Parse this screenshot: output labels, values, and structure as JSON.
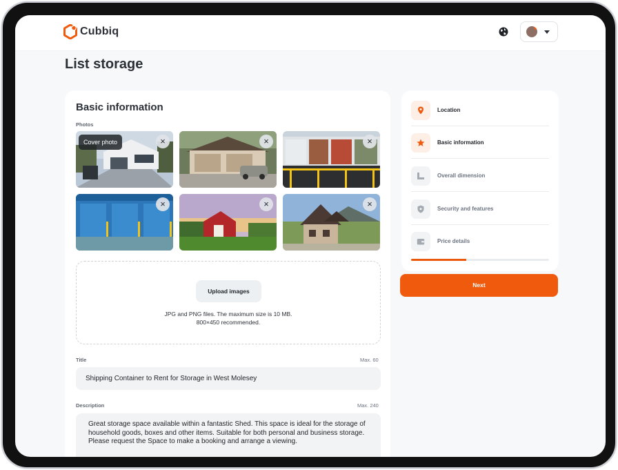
{
  "app": {
    "name": "Cubbiq"
  },
  "header": {
    "globe_icon": "globe-icon",
    "account_icon": "avatar"
  },
  "page": {
    "title": "List storage"
  },
  "basic_info": {
    "title": "Basic information",
    "photos_label": "Photos",
    "cover_badge": "Cover photo",
    "photos": [
      {
        "subject": "modern house with driveway",
        "remove_label": "×"
      },
      {
        "subject": "garage with car",
        "remove_label": "×"
      },
      {
        "subject": "shipping containers",
        "remove_label": "×"
      },
      {
        "subject": "blue storage units",
        "remove_label": "×"
      },
      {
        "subject": "red barn in field",
        "remove_label": "×"
      },
      {
        "subject": "cottage house with mountains",
        "remove_label": "×"
      }
    ],
    "upload": {
      "button_label": "Upload images",
      "hint_line1": "JPG and PNG files. The maximum size is 10 MB.",
      "hint_line2": "800×450 recommended."
    },
    "title_field": {
      "label": "Title",
      "max": "Max. 60",
      "value": "Shipping Container to Rent for Storage in West Molesey"
    },
    "description_field": {
      "label": "Description",
      "max": "Max. 240",
      "value": "Great storage space available within a fantastic Shed. This space is ideal for the storage of household goods, boxes and other items. Suitable for both personal and business storage. Please request the Space to make a booking and arrange a viewing."
    }
  },
  "steps": {
    "items": [
      {
        "label": "Location",
        "icon": "location-pin-icon",
        "state": "active"
      },
      {
        "label": "Basic information",
        "icon": "star-icon",
        "state": "active"
      },
      {
        "label": "Overall dimension",
        "icon": "dimension-icon",
        "state": "pending"
      },
      {
        "label": "Security and features",
        "icon": "shield-icon",
        "state": "pending"
      },
      {
        "label": "Price details",
        "icon": "wallet-icon",
        "state": "pending"
      }
    ],
    "progress": 0.4
  },
  "actions": {
    "next_label": "Next"
  },
  "colors": {
    "accent": "#ef5a0c",
    "accent_soft": "#fdeee6",
    "page_bg": "#f7f8f9",
    "input_bg": "#f1f3f4"
  }
}
